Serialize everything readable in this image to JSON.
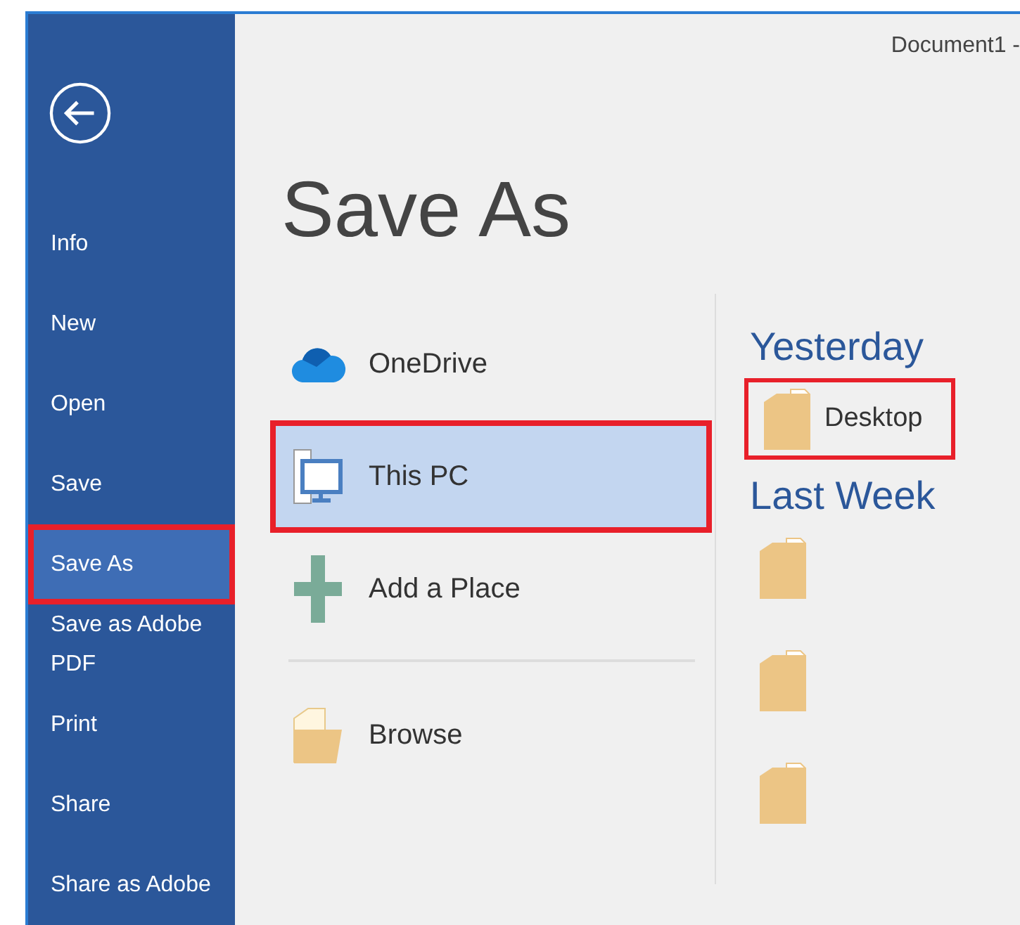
{
  "window": {
    "title": "Document1 -"
  },
  "sidebar": {
    "items": [
      {
        "label": "Info",
        "selected": false,
        "highlighted": false
      },
      {
        "label": "New",
        "selected": false,
        "highlighted": false
      },
      {
        "label": "Open",
        "selected": false,
        "highlighted": false
      },
      {
        "label": "Save",
        "selected": false,
        "highlighted": false
      },
      {
        "label": "Save As",
        "selected": true,
        "highlighted": true
      },
      {
        "label": "Save as Adobe PDF",
        "selected": false,
        "highlighted": false
      },
      {
        "label": "Print",
        "selected": false,
        "highlighted": false
      },
      {
        "label": "Share",
        "selected": false,
        "highlighted": false
      },
      {
        "label": "Share as Adobe",
        "selected": false,
        "highlighted": false
      }
    ]
  },
  "heading": "Save As",
  "places": [
    {
      "kind": "cloud",
      "label": "OneDrive",
      "selected": false,
      "highlighted": false
    },
    {
      "kind": "pc",
      "label": "This PC",
      "selected": true,
      "highlighted": true
    },
    {
      "kind": "add",
      "label": "Add a Place",
      "selected": false,
      "highlighted": false
    },
    {
      "kind": "browse",
      "label": "Browse",
      "selected": false,
      "highlighted": false
    }
  ],
  "recent": [
    {
      "title": "Yesterday",
      "folders": [
        {
          "name": "Desktop",
          "highlighted": true
        }
      ]
    },
    {
      "title": "Last Week",
      "folders": [
        {
          "highlighted": false
        },
        {
          "highlighted": false
        },
        {
          "highlighted": false
        }
      ]
    }
  ]
}
